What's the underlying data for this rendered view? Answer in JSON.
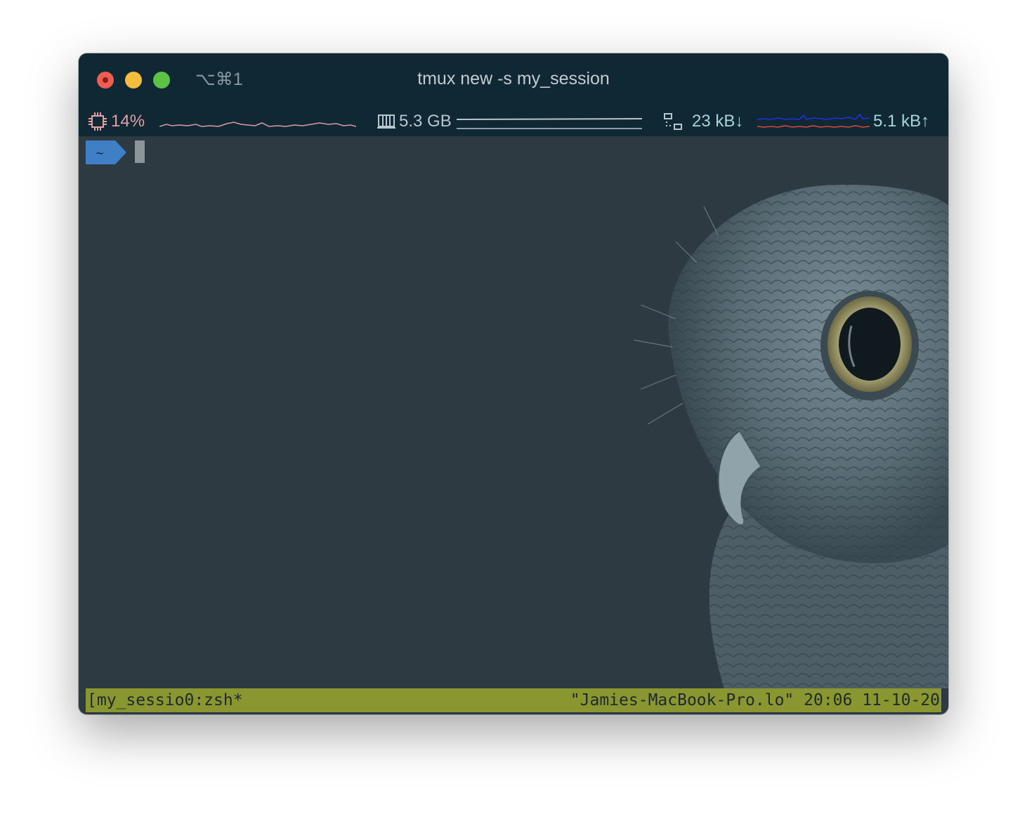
{
  "window": {
    "shortcut": "⌥⌘1",
    "title": "tmux new -s my_session"
  },
  "stats": {
    "cpu": "14%",
    "memory": "5.3 GB",
    "net_down": "23 kB↓",
    "net_up": "5.1 kB↑"
  },
  "prompt": {
    "path": "~"
  },
  "tmux_status": {
    "left": "[my_sessio0:zsh*",
    "right": "\"Jamies-MacBook-Pro.lo\" 20:06 11-10-20"
  },
  "colors": {
    "titlebar": "#0f2834",
    "terminal_bg": "#2d3a42",
    "cpu_text": "#e0a0a5",
    "net_text": "#a8d3d8",
    "prompt_bg": "#3f7fc6",
    "status_bar": "#8a962f"
  },
  "icons": [
    "close-button",
    "minimize-button",
    "maximize-button",
    "cpu-icon",
    "memory-icon",
    "network-icon",
    "owl-wallpaper"
  ]
}
